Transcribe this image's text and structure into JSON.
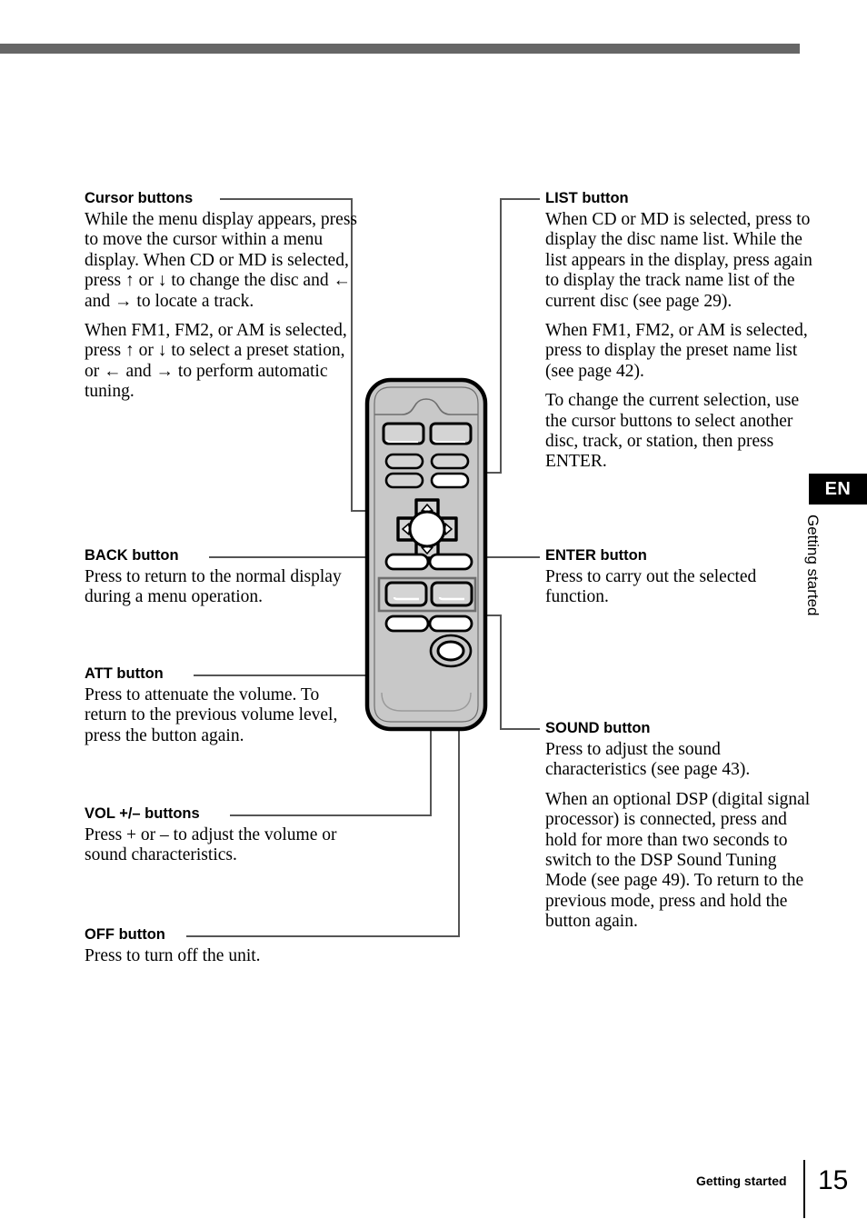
{
  "page": {
    "number": "15",
    "footer_section": "Getting started",
    "language_tab": "EN",
    "side_tab_label": "Getting started"
  },
  "left_column": [
    {
      "id": "cursor",
      "heading": "Cursor buttons",
      "paragraphs": [
        "While the menu display appears, press to move the cursor within a menu display. When CD or MD is selected, press ↑ or ↓ to change the disc and ← and → to locate a track.",
        "When FM1, FM2, or AM is selected, press ↑ or ↓ to select a preset station, or ← and → to perform automatic tuning."
      ]
    },
    {
      "id": "back",
      "heading": "BACK button",
      "paragraphs": [
        "Press to return to the normal display during a menu operation."
      ]
    },
    {
      "id": "att",
      "heading": "ATT button",
      "paragraphs": [
        "Press to attenuate the volume. To return to the previous volume level, press the button again."
      ]
    },
    {
      "id": "vol",
      "heading": "VOL +/– buttons",
      "paragraphs": [
        "Press + or – to adjust the volume or sound characteristics."
      ]
    },
    {
      "id": "off",
      "heading": "OFF button",
      "paragraphs": [
        "Press to turn off the unit."
      ]
    }
  ],
  "right_column": [
    {
      "id": "list",
      "heading": "LIST button",
      "paragraphs": [
        "When CD or MD is selected, press to display the disc name list.  While the list appears in the display, press again to display the track name list of the current disc (see page 29).",
        "When FM1, FM2, or AM is selected, press to display the preset name list (see page 42).",
        "To change the current selection, use the cursor buttons to select another disc, track, or station, then press ENTER."
      ]
    },
    {
      "id": "enter",
      "heading": "ENTER  button",
      "paragraphs": [
        "Press to carry out the selected function."
      ]
    },
    {
      "id": "sound",
      "heading": "SOUND button",
      "paragraphs": [
        "Press to adjust the sound characteristics (see page 43).",
        "When an optional DSP (digital signal processor) is connected, press and hold for more than two seconds to switch to the DSP Sound Tuning Mode (see page 49). To return to the previous mode, press and hold the button again."
      ]
    }
  ],
  "illustration": {
    "name": "remote-control-card-rm-x114",
    "colors": {
      "body": "#c8c8c8",
      "button": "#d4d4d4",
      "highlight": "#ffffff",
      "outline": "#000000",
      "leader": "#555555"
    }
  }
}
